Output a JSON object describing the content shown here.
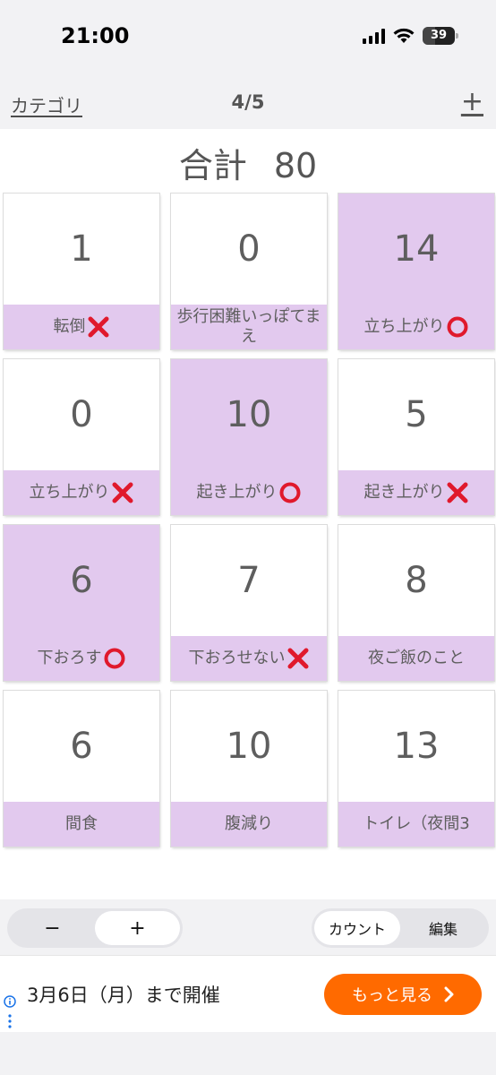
{
  "status_bar": {
    "time": "21:00",
    "battery": "39"
  },
  "nav": {
    "left_label": "カテゴリ",
    "title": "4/5",
    "add_label": "+"
  },
  "total": {
    "label": "合計",
    "value": "80"
  },
  "cards": [
    {
      "count": "1",
      "label": "転倒",
      "mark": "cross",
      "highlight": false
    },
    {
      "count": "0",
      "label": "歩行困難いっぽてまえ",
      "mark": "",
      "highlight": false
    },
    {
      "count": "14",
      "label": "立ち上がり",
      "mark": "circle",
      "highlight": true
    },
    {
      "count": "0",
      "label": "立ち上がり",
      "mark": "cross",
      "highlight": false
    },
    {
      "count": "10",
      "label": "起き上がり",
      "mark": "circle",
      "highlight": true
    },
    {
      "count": "5",
      "label": "起き上がり",
      "mark": "cross",
      "highlight": false
    },
    {
      "count": "6",
      "label": "下おろす",
      "mark": "circle",
      "highlight": true
    },
    {
      "count": "7",
      "label": "下おろせない",
      "mark": "cross",
      "highlight": false
    },
    {
      "count": "8",
      "label": "夜ご飯のこと",
      "mark": "",
      "highlight": false
    },
    {
      "count": "6",
      "label": "間食",
      "mark": "",
      "highlight": false
    },
    {
      "count": "10",
      "label": "腹減り",
      "mark": "",
      "highlight": false
    },
    {
      "count": "13",
      "label": "トイレ（夜間3",
      "mark": "",
      "highlight": false
    }
  ],
  "controls": {
    "decrement": "−",
    "increment": "+",
    "mode_count": "カウント",
    "mode_edit": "編集",
    "active_step": "increment",
    "active_mode": "count"
  },
  "ad": {
    "text": "3月6日（月）まで開催",
    "button": "もっと見る",
    "button_color": "#ff6a00"
  },
  "colors": {
    "highlight": "#e2c9ee",
    "cross": "#e0192c",
    "circle": "#e0192c"
  }
}
